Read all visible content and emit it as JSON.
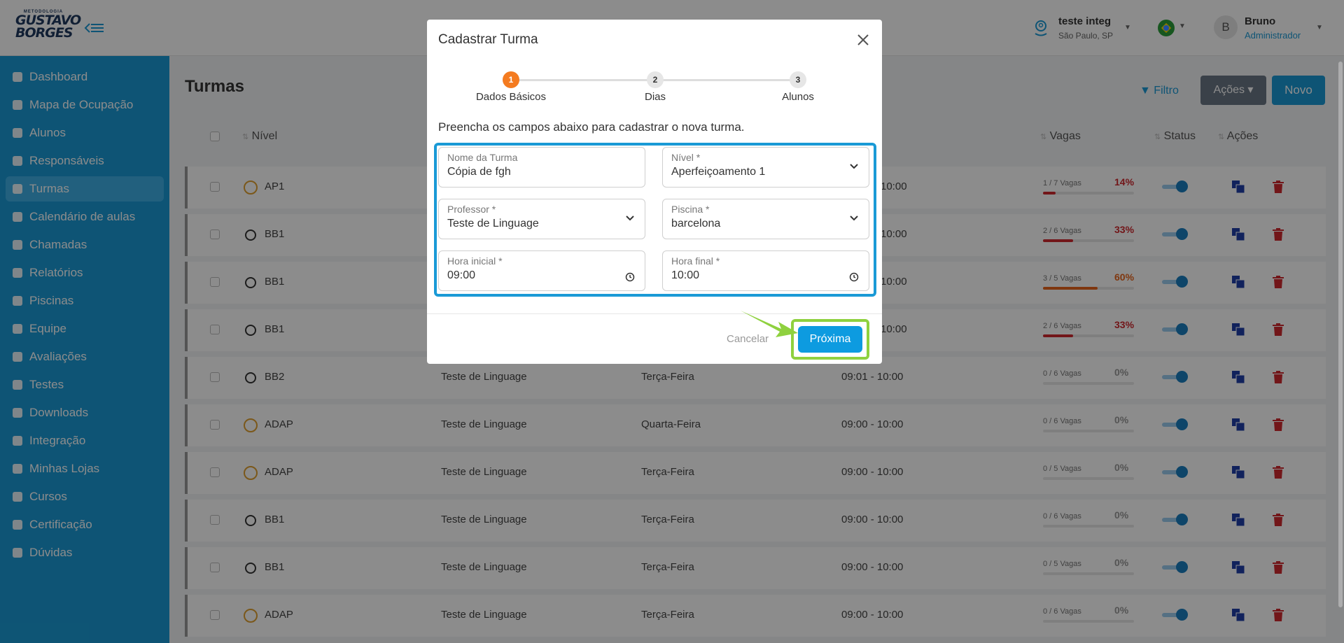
{
  "app": {
    "logo_small": "METODOLOGIA",
    "logo_line1": "GUSTAVO",
    "logo_line2": "BORGES"
  },
  "header": {
    "location_name": "teste integ",
    "location_city": "São Paulo, SP",
    "user_initial": "B",
    "user_name": "Bruno",
    "user_role": "Administrador"
  },
  "sidebar": {
    "items": [
      {
        "label": "Dashboard"
      },
      {
        "label": "Mapa de Ocupação"
      },
      {
        "label": "Alunos"
      },
      {
        "label": "Responsáveis"
      },
      {
        "label": "Turmas"
      },
      {
        "label": "Calendário de aulas"
      },
      {
        "label": "Chamadas"
      },
      {
        "label": "Relatórios"
      },
      {
        "label": "Piscinas"
      },
      {
        "label": "Equipe"
      },
      {
        "label": "Avaliações"
      },
      {
        "label": "Testes"
      },
      {
        "label": "Downloads"
      },
      {
        "label": "Integração"
      },
      {
        "label": "Minhas Lojas"
      },
      {
        "label": "Cursos"
      },
      {
        "label": "Certificação"
      },
      {
        "label": "Dúvidas"
      }
    ],
    "active": "Turmas"
  },
  "page": {
    "title": "Turmas",
    "filter_label": "Filtro",
    "actions_label": "Ações",
    "new_label": "Novo"
  },
  "table": {
    "headers": {
      "nivel": "Nível",
      "vagas": "Vagas",
      "status": "Status",
      "acoes": "Ações"
    },
    "rows": [
      {
        "nivel": "AP1",
        "professor": "",
        "dia": "",
        "horario": "10:00",
        "vagas": "1 / 7 Vagas",
        "pct": "14%",
        "fill": 0.14,
        "color": "#d0282f"
      },
      {
        "nivel": "BB1",
        "professor": "",
        "dia": "",
        "horario": "10:00",
        "vagas": "2 / 6 Vagas",
        "pct": "33%",
        "fill": 0.33,
        "color": "#d0282f"
      },
      {
        "nivel": "BB1",
        "professor": "",
        "dia": "",
        "horario": "10:00",
        "vagas": "3 / 5 Vagas",
        "pct": "60%",
        "fill": 0.6,
        "color": "#e8651c"
      },
      {
        "nivel": "BB1",
        "professor": "",
        "dia": "",
        "horario": "10:00",
        "vagas": "2 / 6 Vagas",
        "pct": "33%",
        "fill": 0.33,
        "color": "#d0282f"
      },
      {
        "nivel": "BB2",
        "professor": "Teste de Linguage",
        "dia": "Terça-Feira",
        "horario": "09:01 - 10:00",
        "vagas": "0 / 6 Vagas",
        "pct": "0%",
        "fill": 0,
        "color": "#999999"
      },
      {
        "nivel": "ADAP",
        "professor": "Teste de Linguage",
        "dia": "Quarta-Feira",
        "horario": "09:00 - 10:00",
        "vagas": "0 / 6 Vagas",
        "pct": "0%",
        "fill": 0,
        "color": "#999999"
      },
      {
        "nivel": "ADAP",
        "professor": "Teste de Linguage",
        "dia": "Terça-Feira",
        "horario": "09:00 - 10:00",
        "vagas": "0 / 5 Vagas",
        "pct": "0%",
        "fill": 0,
        "color": "#999999"
      },
      {
        "nivel": "BB1",
        "professor": "Teste de Linguage",
        "dia": "Terça-Feira",
        "horario": "09:00 - 10:00",
        "vagas": "0 / 6 Vagas",
        "pct": "0%",
        "fill": 0,
        "color": "#999999"
      },
      {
        "nivel": "BB1",
        "professor": "Teste de Linguage",
        "dia": "Terça-Feira",
        "horario": "09:00 - 10:00",
        "vagas": "0 / 5 Vagas",
        "pct": "0%",
        "fill": 0,
        "color": "#999999"
      },
      {
        "nivel": "ADAP",
        "professor": "Teste de Linguage",
        "dia": "Terça-Feira",
        "horario": "09:00 - 10:00",
        "vagas": "0 / 6 Vagas",
        "pct": "0%",
        "fill": 0,
        "color": "#999999"
      }
    ]
  },
  "modal": {
    "title": "Cadastrar Turma",
    "steps": [
      {
        "number": "1",
        "label": "Dados Básicos"
      },
      {
        "number": "2",
        "label": "Dias"
      },
      {
        "number": "3",
        "label": "Alunos"
      }
    ],
    "description": "Preencha os campos abaixo para cadastrar o nova turma.",
    "fields": {
      "nome": {
        "label": "Nome da Turma",
        "value": "Cópia de fgh"
      },
      "nivel": {
        "label": "Nível *",
        "value": "Aperfeiçoamento 1"
      },
      "professor": {
        "label": "Professor *",
        "value": "Teste de Linguage"
      },
      "piscina": {
        "label": "Piscina *",
        "value": "barcelona"
      },
      "hora_inicial": {
        "label": "Hora inicial *",
        "value": "09:00"
      },
      "hora_final": {
        "label": "Hora final *",
        "value": "10:00"
      }
    },
    "cancel_label": "Cancelar",
    "next_label": "Próxima"
  },
  "colors": {
    "primary": "#1a9ad6",
    "step_active": "#f47b20",
    "highlight": "#8fd13f"
  }
}
